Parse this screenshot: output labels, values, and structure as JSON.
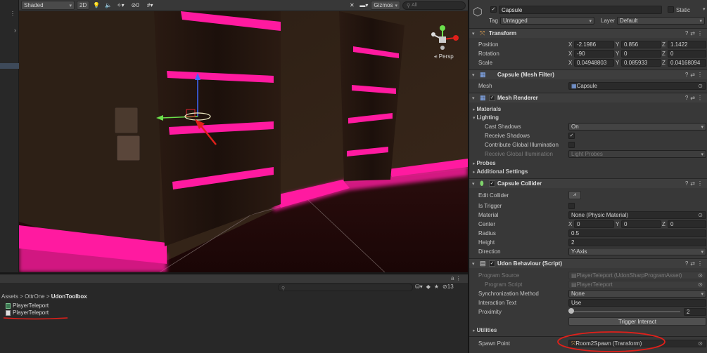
{
  "toolbar": {
    "shading_mode": "Shaded",
    "mode_2d": "2D",
    "hidden_count": "0",
    "gizmos_label": "Gizmos",
    "search_placeholder": "All"
  },
  "viewport": {
    "persp_label": "Persp"
  },
  "project": {
    "breadcrumb": [
      "Assets",
      "OttrOne",
      "UdonToolbox"
    ],
    "assets": [
      "PlayerTeleport",
      "PlayerTeleport"
    ],
    "hidden_count": "13"
  },
  "inspector": {
    "object_name": "Capsule",
    "static_label": "Static",
    "tag_label": "Tag",
    "tag_value": "Untagged",
    "layer_label": "Layer",
    "layer_value": "Default",
    "transform": {
      "title": "Transform",
      "position_label": "Position",
      "rotation_label": "Rotation",
      "scale_label": "Scale",
      "position": {
        "x": "-2.1986",
        "y": "0.856",
        "z": "1.1422"
      },
      "rotation": {
        "x": "-90",
        "y": "0",
        "z": "0"
      },
      "scale": {
        "x": "0.04948803",
        "y": "0.085933",
        "z": "0.04168094"
      }
    },
    "mesh_filter": {
      "title": "Capsule (Mesh Filter)",
      "mesh_label": "Mesh",
      "mesh_value": "Capsule"
    },
    "mesh_renderer": {
      "title": "Mesh Renderer",
      "materials": "Materials",
      "lighting": "Lighting",
      "cast_shadows_label": "Cast Shadows",
      "cast_shadows_value": "On",
      "receive_shadows_label": "Receive Shadows",
      "contribute_gi_label": "Contribute Global Illumination",
      "receive_gi_label": "Receive Global Illumination",
      "receive_gi_value": "Light Probes",
      "probes": "Probes",
      "additional": "Additional Settings"
    },
    "capsule_collider": {
      "title": "Capsule Collider",
      "edit_label": "Edit Collider",
      "is_trigger_label": "Is Trigger",
      "material_label": "Material",
      "material_value": "None (Physic Material)",
      "center_label": "Center",
      "center": {
        "x": "0",
        "y": "0",
        "z": "0"
      },
      "radius_label": "Radius",
      "radius_value": "0.5",
      "height_label": "Height",
      "height_value": "2",
      "direction_label": "Direction",
      "direction_value": "Y-Axis"
    },
    "udon": {
      "title": "Udon Behaviour (Script)",
      "program_source_label": "Program Source",
      "program_source_value": "PlayerTeleport (UdonSharpProgramAsset)",
      "program_script_label": "Program Script",
      "program_script_value": "PlayerTeleport",
      "sync_label": "Synchronization Method",
      "sync_value": "None",
      "interaction_label": "Interaction Text",
      "interaction_value": "Use",
      "proximity_label": "Proximity",
      "proximity_value": "2",
      "proximity_fraction": 0.0,
      "trigger_button": "Trigger Interact",
      "utilities": "Utilities",
      "spawn_label": "Spawn Point",
      "spawn_value": "Room2Spawn (Transform)"
    }
  },
  "colors": {
    "neon": "#ff1aa0",
    "annotation": "#e0201a",
    "panel": "#383838"
  }
}
